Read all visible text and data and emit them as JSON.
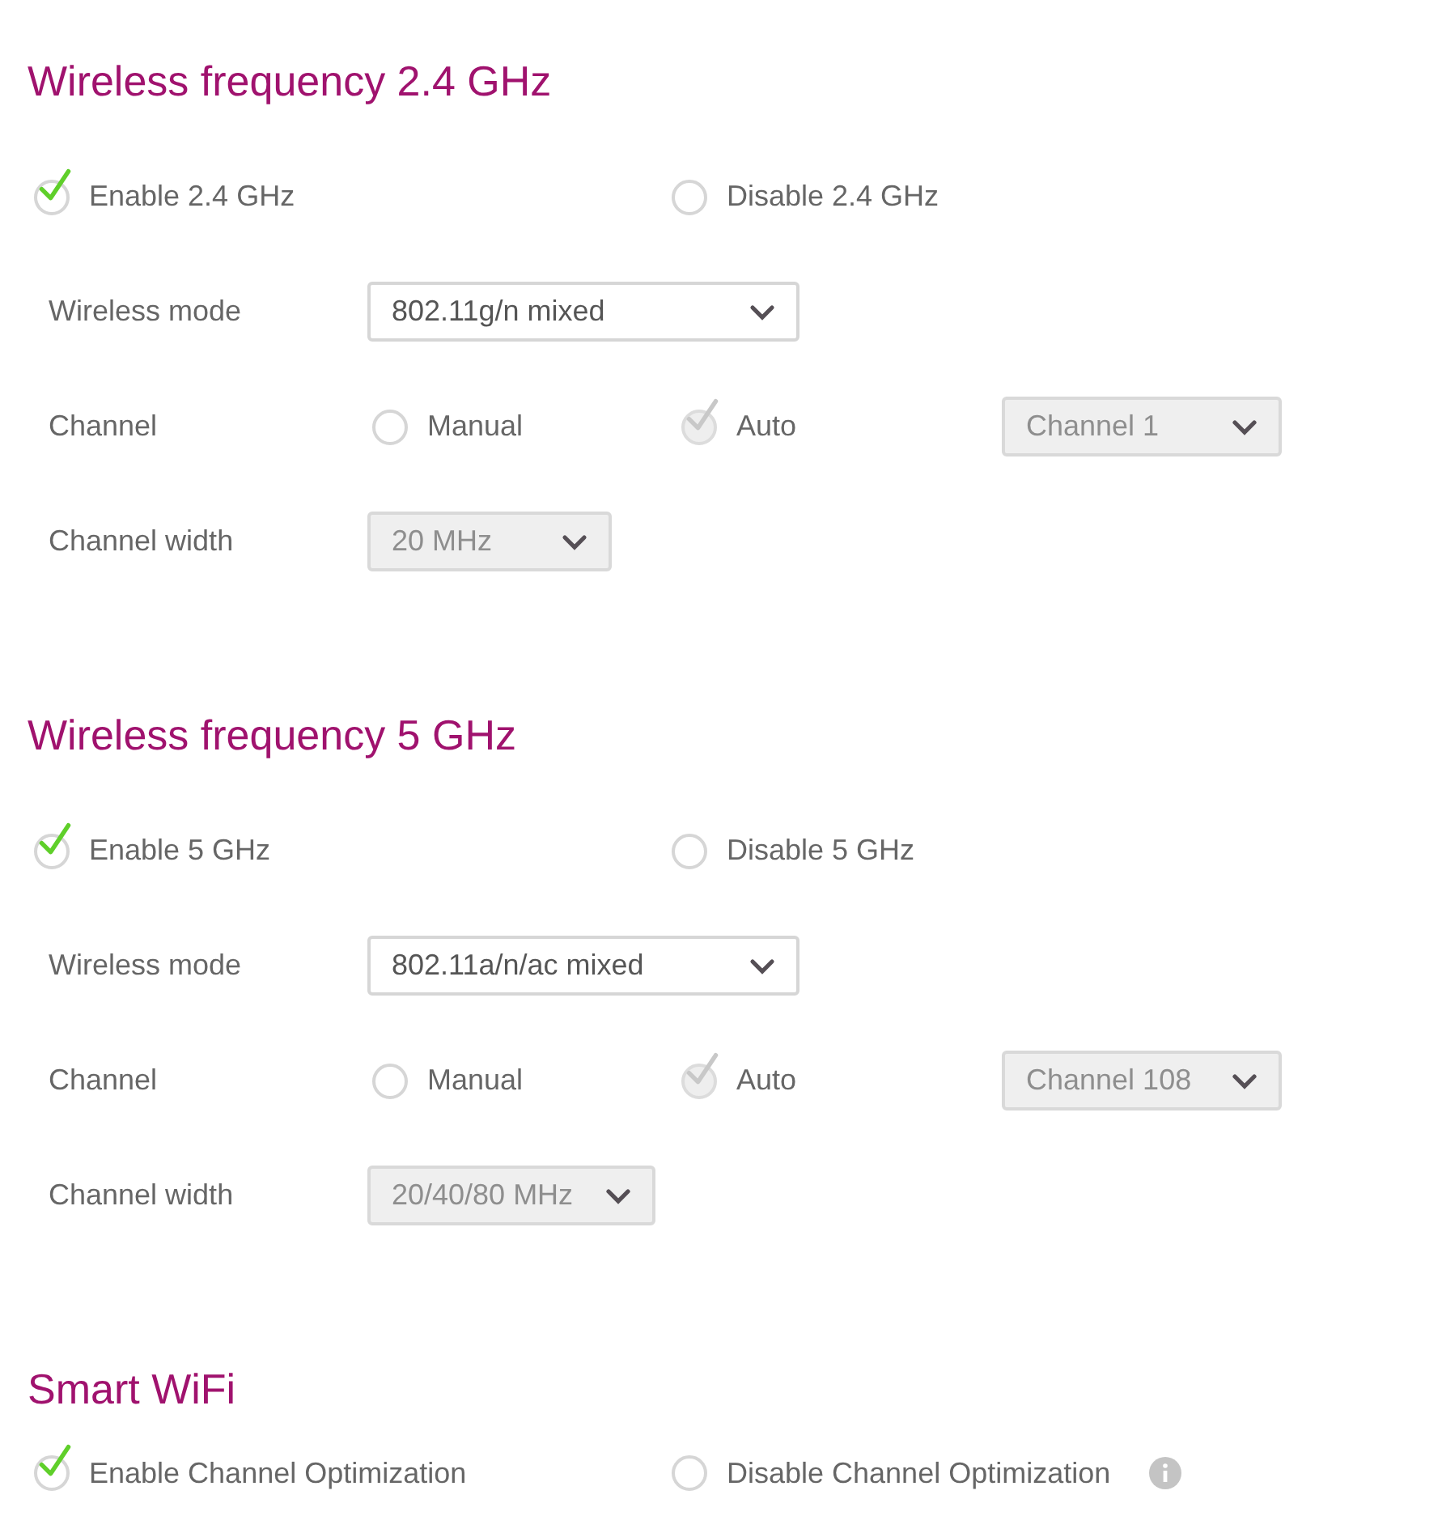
{
  "sections": [
    {
      "title": "Wireless frequency 2.4 GHz",
      "options": [
        {
          "label": "Enable 2.4 GHz",
          "selected": true
        },
        {
          "label": "Disable 2.4 GHz",
          "selected": false
        }
      ],
      "mode": {
        "label": "Wireless mode",
        "value": "802.11g/n mixed"
      },
      "channel": {
        "label": "Channel",
        "options": [
          {
            "label": "Manual",
            "selected": false,
            "disabled": false
          },
          {
            "label": "Auto",
            "selected": true,
            "disabled": true
          }
        ],
        "select": {
          "value": "Channel 1",
          "disabled": true
        }
      },
      "width": {
        "label": "Channel width",
        "value": "20 MHz",
        "disabled": true
      }
    },
    {
      "title": "Wireless frequency 5 GHz",
      "options": [
        {
          "label": "Enable 5 GHz",
          "selected": true
        },
        {
          "label": "Disable 5 GHz",
          "selected": false
        }
      ],
      "mode": {
        "label": "Wireless mode",
        "value": "802.11a/n/ac mixed"
      },
      "channel": {
        "label": "Channel",
        "options": [
          {
            "label": "Manual",
            "selected": false,
            "disabled": false
          },
          {
            "label": "Auto",
            "selected": true,
            "disabled": true
          }
        ],
        "select": {
          "value": "Channel 108",
          "disabled": true
        }
      },
      "width": {
        "label": "Channel width",
        "value": "20/40/80 MHz",
        "disabled": true
      }
    },
    {
      "title": "Smart WiFi",
      "options": [
        {
          "label": "Enable Channel Optimization",
          "selected": true
        },
        {
          "label": "Disable Channel Optimization",
          "selected": false,
          "info": true
        }
      ]
    }
  ]
}
